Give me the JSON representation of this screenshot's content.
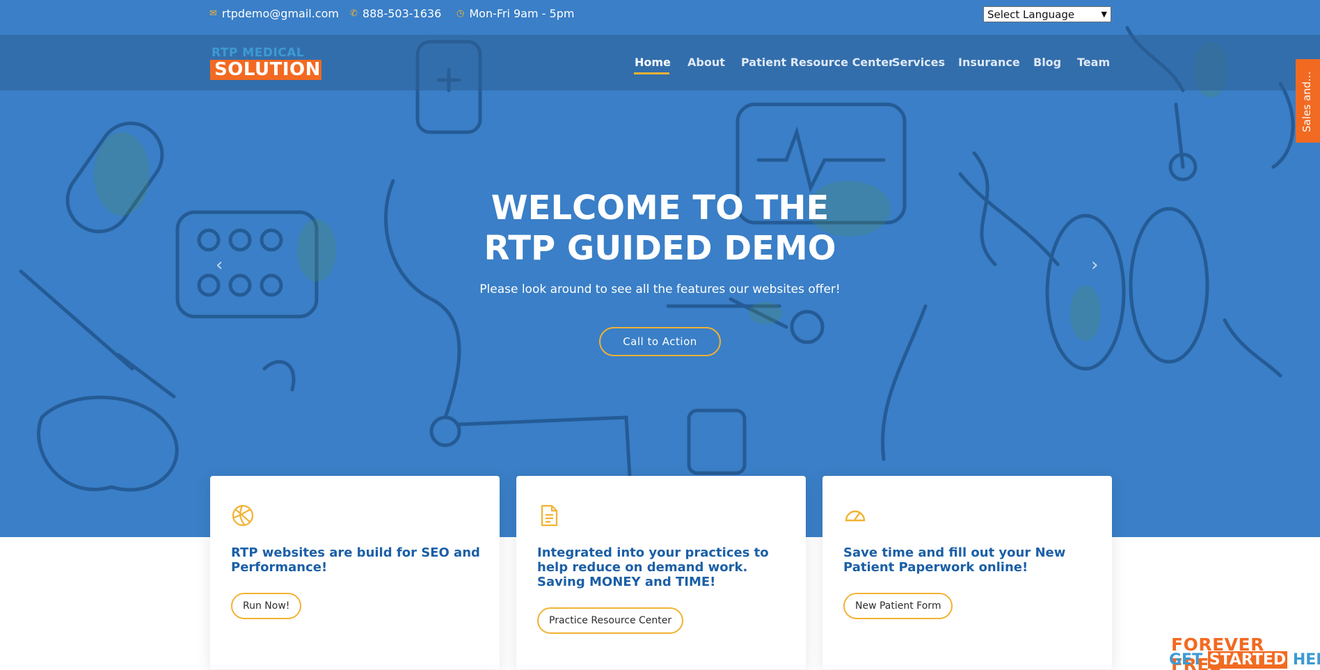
{
  "topbar": {
    "email": "rtpdemo@gmail.com",
    "phone": "888-503-1636",
    "hours": "Mon-Fri 9am - 5pm",
    "language_select": "Select Language"
  },
  "logo": {
    "line1": "RTP MEDICAL",
    "line2": "SOLUTION"
  },
  "nav": {
    "items": [
      "Home",
      "About",
      "Patient Resource Center",
      "Services",
      "Insurance",
      "Blog",
      "Team"
    ],
    "active": "Home"
  },
  "side_tab": "Sales and...",
  "hero": {
    "title_line1": "WELCOME TO THE",
    "title_line2": "RTP GUIDED DEMO",
    "subtitle": "Please look around to see all the features our websites offer!",
    "cta": "Call to Action",
    "prev_icon": "chevron-left",
    "next_icon": "chevron-right"
  },
  "cards": [
    {
      "icon": "basketball-icon",
      "text": "RTP websites are build for SEO and Performance!",
      "button": "Run Now!"
    },
    {
      "icon": "document-icon",
      "text": "Integrated into your practices to help reduce on demand work. Saving MONEY and TIME!",
      "button": "Practice Resource Center"
    },
    {
      "icon": "speedometer-icon",
      "text": "Save time and fill out your New Patient Paperwork online!",
      "button": "New Patient Form"
    }
  ],
  "promo": {
    "line1": "FOREVER FREE",
    "line2_a": "GET ",
    "line2_b": "STARTED",
    "line2_c": " HERE"
  },
  "colors": {
    "hero_blue": "#3a7fc7",
    "accent_gold": "#f2b233",
    "accent_orange": "#f26a21",
    "card_text_blue": "#1b5fa6"
  }
}
